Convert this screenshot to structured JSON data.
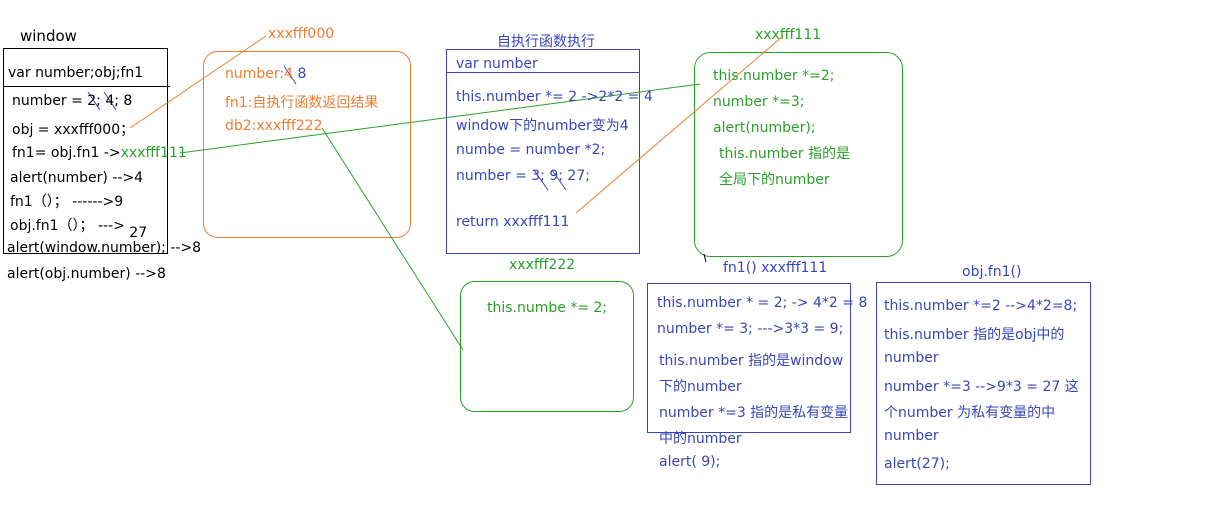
{
  "window_box": {
    "title": "window",
    "header": "var number;obj;fn1",
    "lines": [
      "number = 2; 4; 8",
      "obj = xxxfff000；",
      "fn1= obj.fn1 ->",
      "alert(number) -->4",
      "fn1（）； ------>9",
      "obj.fn1（）； --->",
      "alert(window.number); -->8",
      "alert(obj.number) -->8"
    ],
    "fn1_target": "xxxfff111",
    "objfn1_result": "27",
    "number_crossed": [
      "2",
      "4"
    ],
    "number_new": "8"
  },
  "obj_box": {
    "title": "xxxfff000",
    "lines": [
      "number:4",
      "fn1:自执行函数返回结果",
      "db2:xxxfff222"
    ],
    "number_new": "8"
  },
  "iife_box": {
    "title": "自执行函数执行",
    "header": "var number",
    "lines": [
      "this.number *= 2  ->2*2 = 4",
      "window下的number变为4",
      "numbe = number *2;",
      "number = 3;  9; 27;",
      "return xxxfff111"
    ]
  },
  "fn_box": {
    "title": "xxxfff111",
    "lines": [
      "this.number *=2;",
      "number *=3;",
      "alert(number);",
      "this.number 指的是",
      "全局下的number"
    ]
  },
  "db2_box": {
    "title": "xxxfff222",
    "lines": [
      "this.numbe *= 2;"
    ]
  },
  "fn1_call_box": {
    "title": "fn1()  xxxfff111",
    "lines": [
      "this.number * = 2; -> 4*2 = 8",
      "number *= 3; --->3*3 = 9;",
      "this.number 指的是window",
      "下的number",
      "number *=3 指的是私有变量",
      "中的number",
      "alert(  9);"
    ]
  },
  "obj_fn1_box": {
    "title": "obj.fn1()",
    "lines": [
      "this.number *=2 -->4*2=8;",
      "this.number 指的是obj中的",
      "number",
      "number  *=3 -->9*3 = 27 这",
      "个number 为私有变量的中",
      "number",
      " alert(27);"
    ]
  },
  "colors": {
    "black": "#000000",
    "orange": "#ed7d31",
    "green": "#2aa02a",
    "blue": "#3a45b8"
  }
}
